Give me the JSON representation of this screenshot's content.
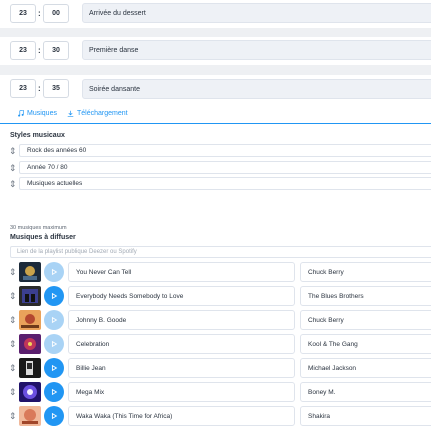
{
  "timeline": [
    {
      "hour": "23",
      "minute": "00",
      "label": "Arrivée du dessert"
    },
    {
      "hour": "23",
      "minute": "30",
      "label": "Première danse"
    },
    {
      "hour": "23",
      "minute": "35",
      "label": "Soirée dansante"
    }
  ],
  "separator": ":",
  "tabs": [
    {
      "label": "Musiques",
      "icon": "music-note-icon",
      "active": true
    },
    {
      "label": "Téléchargement",
      "icon": "download-icon",
      "active": false
    }
  ],
  "styles": {
    "title": "Styles musicaux",
    "items": [
      "Rock des années 60",
      "Année 70 / 80",
      "Musiques actuelles"
    ]
  },
  "music": {
    "max_note": "30 musiques maximum",
    "title": "Musiques à diffuser",
    "playlist_placeholder": "Lien de la playlist publique Deezer ou Spotify",
    "songs": [
      {
        "title": "You Never Can Tell",
        "artist": "Chuck Berry",
        "enabled": false
      },
      {
        "title": "Everybody Needs Somebody to Love",
        "artist": "The Blues Brothers",
        "enabled": true
      },
      {
        "title": "Johnny B. Goode",
        "artist": "Chuck Berry",
        "enabled": false
      },
      {
        "title": "Celebration",
        "artist": "Kool & The Gang",
        "enabled": false
      },
      {
        "title": "Billie Jean",
        "artist": "Michael Jackson",
        "enabled": true
      },
      {
        "title": "Mega Mix",
        "artist": "Boney M.",
        "enabled": true
      },
      {
        "title": "Waka Waka (This Time for Africa)",
        "artist": "Shakira",
        "enabled": true
      }
    ]
  },
  "colors": {
    "accent": "#2196f3",
    "play_disabled": "#a9d3f5",
    "field_bg": "#eef1f6"
  }
}
